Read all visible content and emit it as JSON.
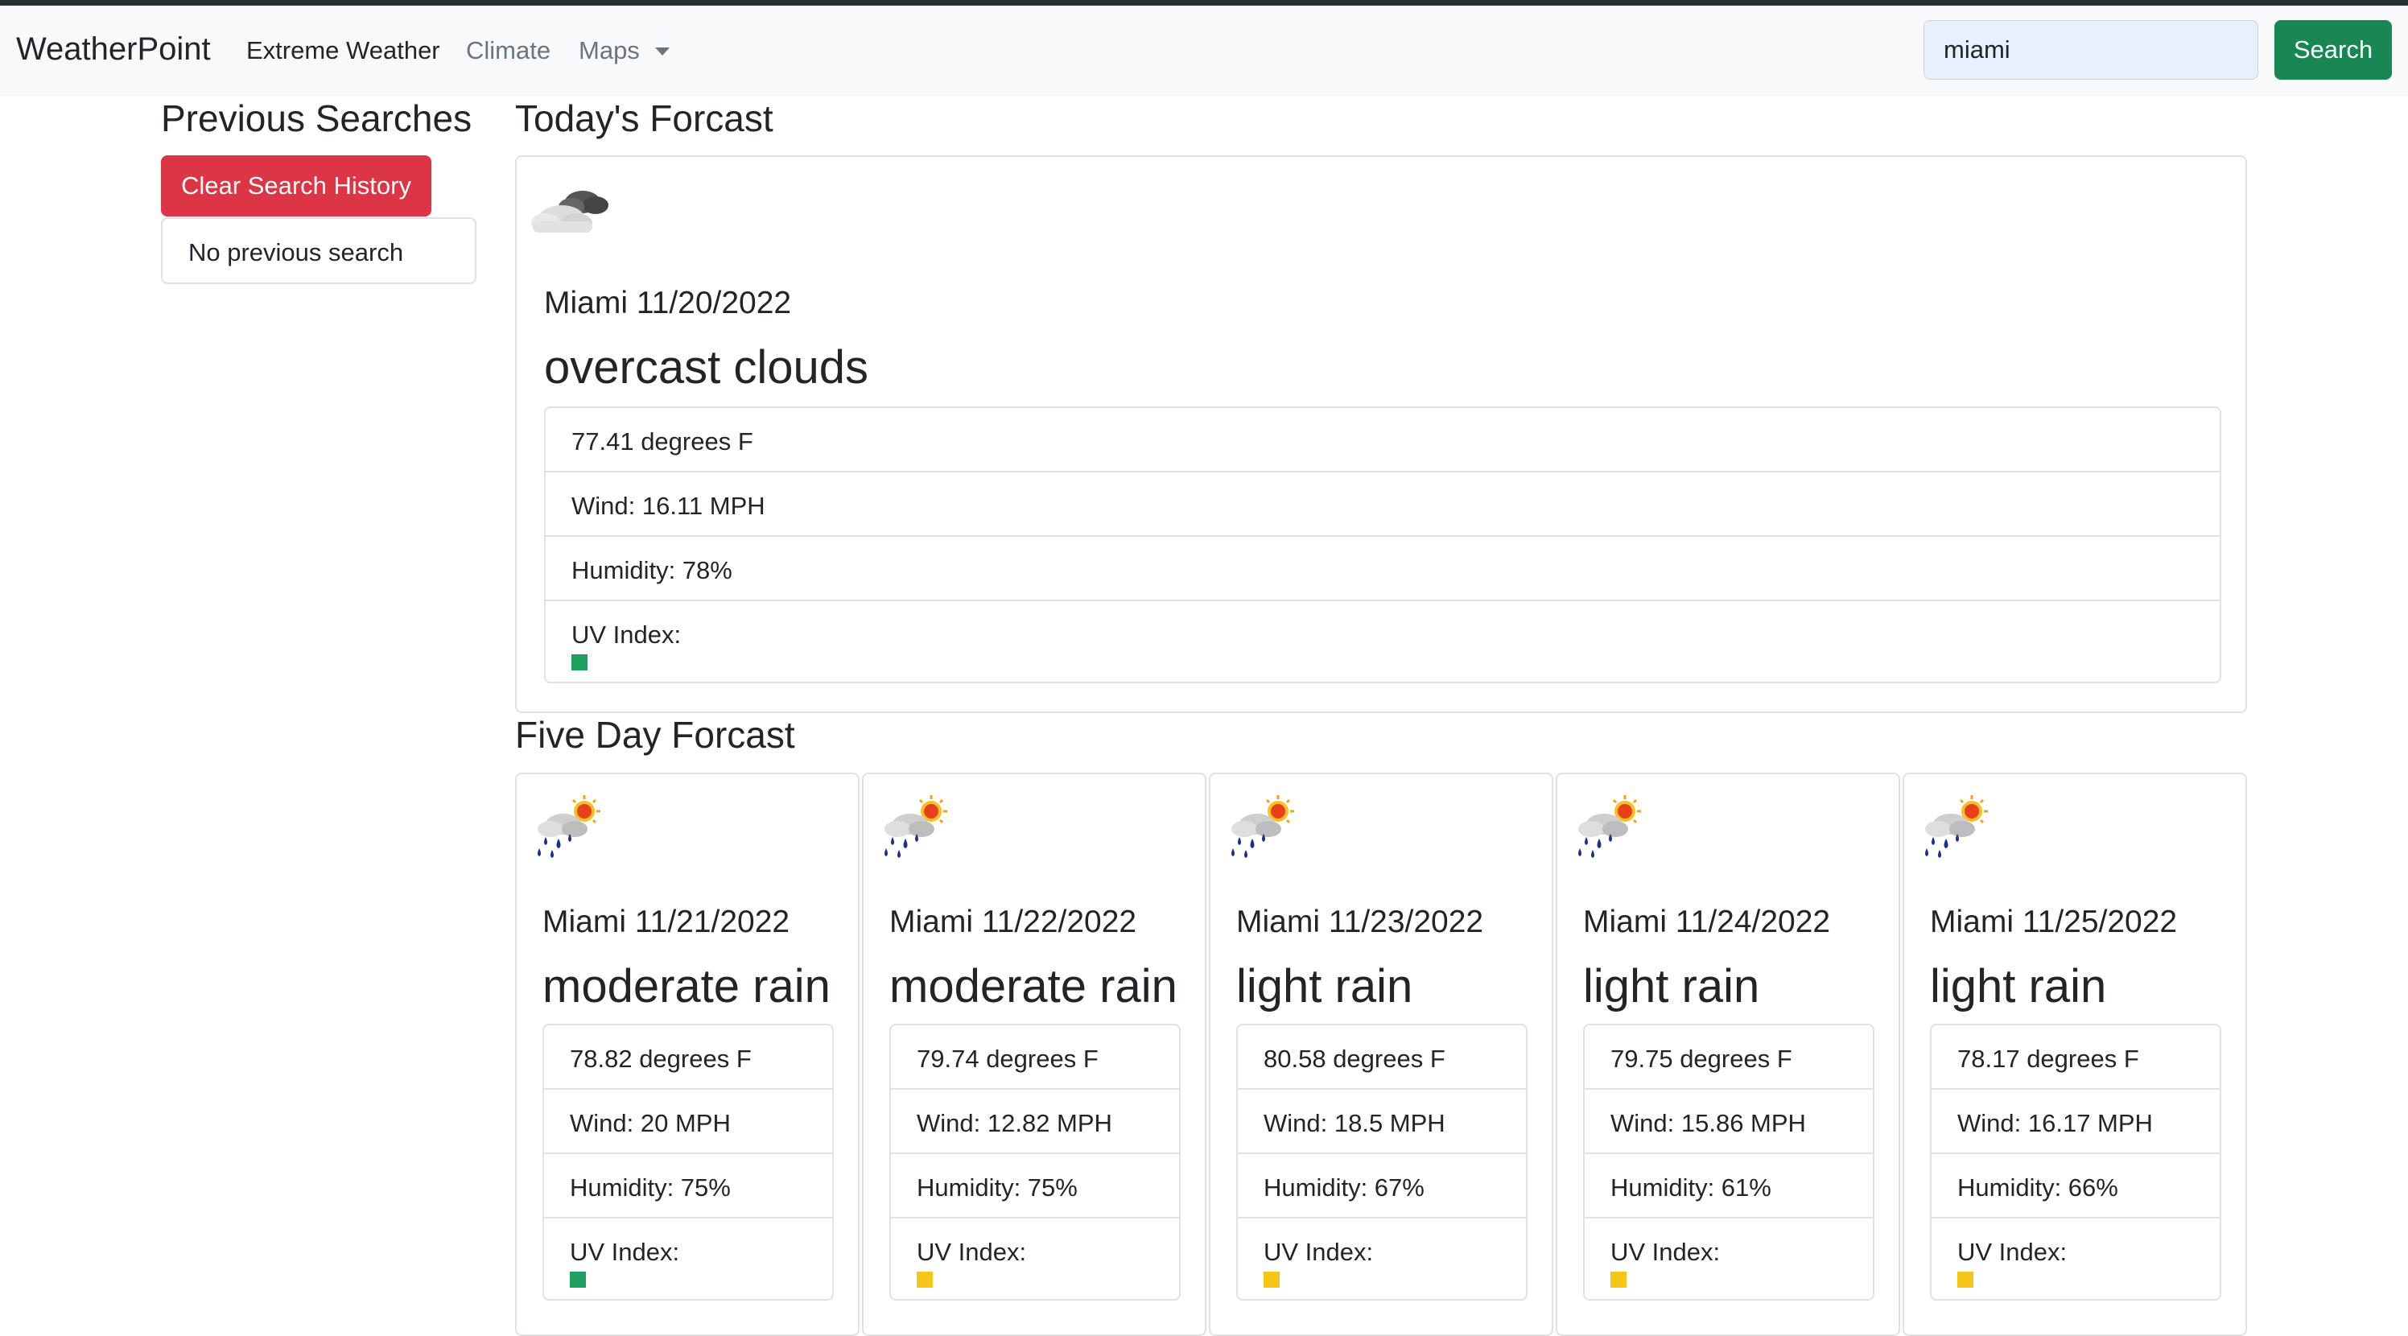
{
  "navbar": {
    "brand": "WeatherPoint",
    "links": [
      "Extreme Weather",
      "Climate",
      "Maps"
    ],
    "search_value": "miami",
    "search_button": "Search"
  },
  "sidebar": {
    "title": "Previous Searches",
    "clear_button": "Clear Search History",
    "empty_text": "No previous search"
  },
  "today": {
    "heading": "Today's Forcast",
    "icon": "overcast-clouds-icon",
    "city_date": "Miami 11/20/2022",
    "description": "overcast clouds",
    "temp": "77.41 degrees F",
    "wind": "Wind: 16.11 MPH",
    "humidity": "Humidity: 78%",
    "uv_label": "UV Index:",
    "uv_color": "#20a060"
  },
  "forecast": {
    "heading": "Five Day Forcast",
    "days": [
      {
        "icon": "rain-sun-icon",
        "city_date": "Miami 11/21/2022",
        "description": "moderate rain",
        "temp": "78.82 degrees F",
        "wind": "Wind: 20 MPH",
        "humidity": "Humidity: 75%",
        "uv_label": "UV Index:",
        "uv_color": "#20a060"
      },
      {
        "icon": "rain-sun-icon",
        "city_date": "Miami 11/22/2022",
        "description": "moderate rain",
        "temp": "79.74 degrees F",
        "wind": "Wind: 12.82 MPH",
        "humidity": "Humidity: 75%",
        "uv_label": "UV Index:",
        "uv_color": "#f5c518"
      },
      {
        "icon": "rain-sun-icon",
        "city_date": "Miami 11/23/2022",
        "description": "light rain",
        "temp": "80.58 degrees F",
        "wind": "Wind: 18.5 MPH",
        "humidity": "Humidity: 67%",
        "uv_label": "UV Index:",
        "uv_color": "#f5c518"
      },
      {
        "icon": "rain-sun-icon",
        "city_date": "Miami 11/24/2022",
        "description": "light rain",
        "temp": "79.75 degrees F",
        "wind": "Wind: 15.86 MPH",
        "humidity": "Humidity: 61%",
        "uv_label": "UV Index:",
        "uv_color": "#f5c518"
      },
      {
        "icon": "rain-sun-icon",
        "city_date": "Miami 11/25/2022",
        "description": "light rain",
        "temp": "78.17 degrees F",
        "wind": "Wind: 16.17 MPH",
        "humidity": "Humidity: 66%",
        "uv_label": "UV Index:",
        "uv_color": "#f5c518"
      }
    ]
  }
}
